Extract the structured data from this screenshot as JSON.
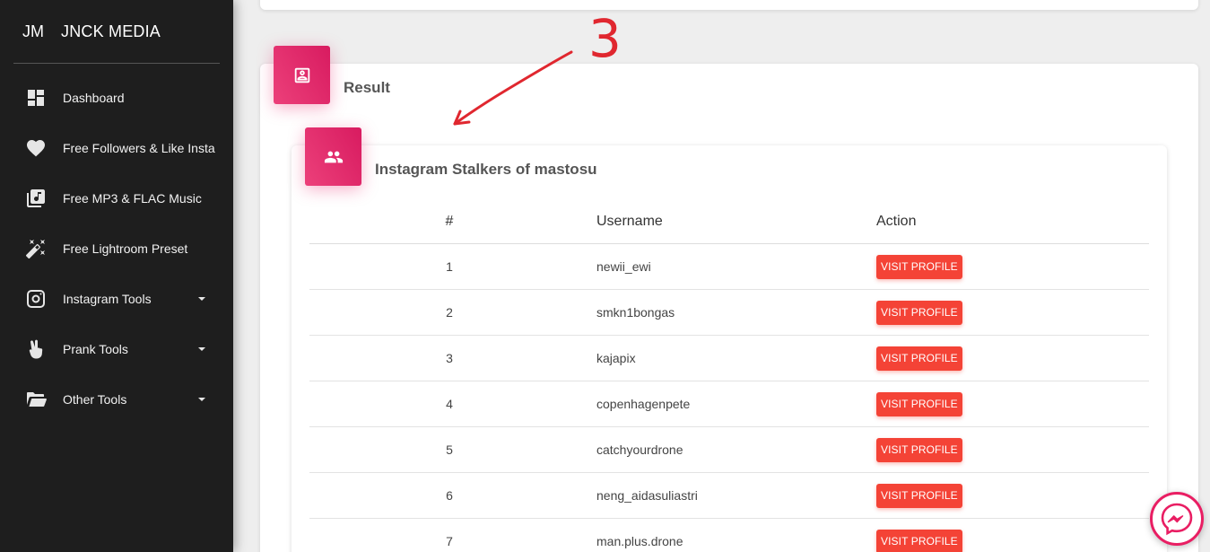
{
  "sidebar": {
    "brand_mini": "JM",
    "brand_full": "JNCK MEDIA",
    "items": [
      {
        "label": "Dashboard",
        "icon": "dashboard-icon",
        "has_caret": false
      },
      {
        "label": "Free Followers & Like Insta",
        "icon": "heart-icon",
        "has_caret": false
      },
      {
        "label": "Free MP3 & FLAC Music",
        "icon": "music-library-icon",
        "has_caret": false
      },
      {
        "label": "Free Lightroom Preset",
        "icon": "magic-wand-icon",
        "has_caret": false
      },
      {
        "label": "Instagram Tools",
        "icon": "instagram-icon",
        "has_caret": true
      },
      {
        "label": "Prank Tools",
        "icon": "victory-hand-icon",
        "has_caret": true
      },
      {
        "label": "Other Tools",
        "icon": "folder-open-icon",
        "has_caret": true
      }
    ]
  },
  "result": {
    "title": "Result",
    "icon": "contact-card-icon"
  },
  "stalkers": {
    "title": "Instagram Stalkers of mastosu",
    "icon": "people-icon",
    "columns": [
      "#",
      "Username",
      "Action"
    ],
    "rows": [
      {
        "num": "1",
        "username": "newii_ewi",
        "action": "VISIT PROFILE"
      },
      {
        "num": "2",
        "username": "smkn1bongas",
        "action": "VISIT PROFILE"
      },
      {
        "num": "3",
        "username": "kajapix",
        "action": "VISIT PROFILE"
      },
      {
        "num": "4",
        "username": "copenhagenpete",
        "action": "VISIT PROFILE"
      },
      {
        "num": "5",
        "username": "catchyourdrone",
        "action": "VISIT PROFILE"
      },
      {
        "num": "6",
        "username": "neng_aidasuliastri",
        "action": "VISIT PROFILE"
      },
      {
        "num": "7",
        "username": "man.plus.drone",
        "action": "VISIT PROFILE"
      }
    ]
  },
  "annotation": {
    "number": "3",
    "color": "#e0272f"
  },
  "colors": {
    "accent_pink": "#e91e63",
    "button_red": "#f44336",
    "sidebar_bg": "#1e1e1e"
  },
  "messenger": {
    "icon": "messenger-icon"
  }
}
